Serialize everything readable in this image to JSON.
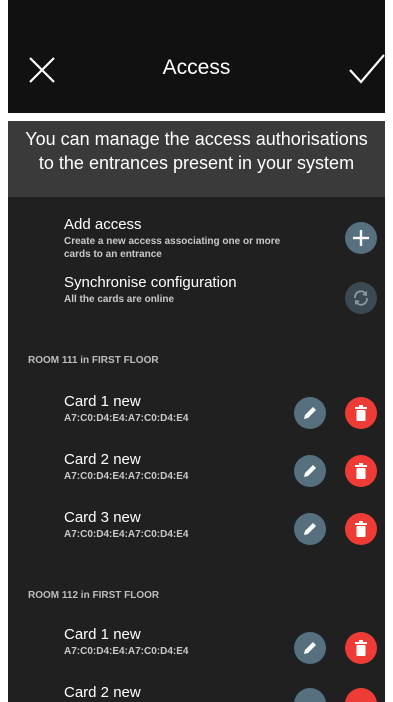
{
  "header": {
    "title": "Access",
    "close_icon": "close-icon",
    "confirm_icon": "check-icon"
  },
  "info": {
    "line1": "You can manage the access authorisations",
    "line2": "to the entrances present in your system"
  },
  "actions": {
    "add": {
      "title": "Add access",
      "sub1": "Create a new access associating one or more",
      "sub2": "cards to an entrance",
      "icon": "plus-icon"
    },
    "sync": {
      "title": "Synchronise configuration",
      "sub": "All the cards are online",
      "icon": "sync-icon"
    }
  },
  "groups": [
    {
      "label": "ROOM 111 in FIRST FLOOR",
      "cards": [
        {
          "name": "Card 1 new",
          "id": "A7:C0:D4:E4:A7:C0:D4:E4"
        },
        {
          "name": "Card 2 new",
          "id": "A7:C0:D4:E4:A7:C0:D4:E4"
        },
        {
          "name": "Card 3 new",
          "id": "A7:C0:D4:E4:A7:C0:D4:E4"
        }
      ]
    },
    {
      "label": "ROOM 112 in FIRST FLOOR",
      "cards": [
        {
          "name": "Card 1 new",
          "id": "A7:C0:D4:E4:A7:C0:D4:E4"
        },
        {
          "name": "Card 2 new",
          "id": ""
        }
      ]
    }
  ],
  "colors": {
    "edit": "#56707f",
    "delete": "#ef3b35",
    "background": "#202020"
  }
}
